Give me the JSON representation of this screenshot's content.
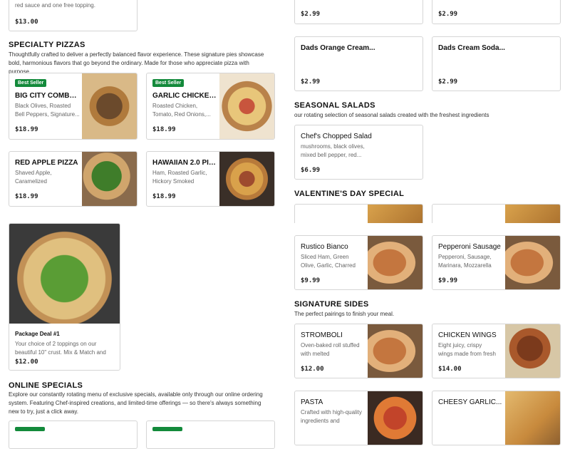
{
  "top_left_card": {
    "desc_tail": "red sauce and one free topping.",
    "price": "$13.00"
  },
  "specialty": {
    "title": "SPECIALTY PIZZAS",
    "description": "Thoughtfully crafted to deliver a perfectly balanced flavor experience. These signature pies showcase bold, harmonious flavors that go beyond the ordinary. Made for those who appreciate pizza with purpose.",
    "items": [
      {
        "badge": "Best Seller",
        "name": "BIG CITY COMBO...",
        "desc": "Black Olives, Roasted Bell Peppers, Signature...",
        "price": "$18.99"
      },
      {
        "badge": "Best Seller",
        "name": "GARLIC CHICKEN...",
        "desc": "Roasted Chicken, Tomato, Red Onions,...",
        "price": "$18.99"
      },
      {
        "name": "RED APPLE PIZZA",
        "desc": "Shaved Apple, Caramelized Onions,...",
        "price": "$18.99"
      },
      {
        "name": "HAWAIIAN 2.0 PIZZA",
        "desc": "Ham, Roasted Garlic, Hickory Smoked Bacon,...",
        "price": "$18.99"
      }
    ]
  },
  "package_deal": {
    "name": "Package Deal #1",
    "desc": "Your choice of 2 toppings on our beautiful 10\" crust. Mix & Match and enjoy!",
    "price": "$12.00"
  },
  "online_specials": {
    "title": "ONLINE SPECIALS",
    "description": "Explore our constantly rotating menu of exclusive specials, available only through our online ordering system. Featuring Chef-inspired creations, and limited-time offerings — so there's always something new to try, just a click away."
  },
  "drinks": [
    {
      "price": "$2.99"
    },
    {
      "price": "$2.99"
    },
    {
      "name": "Dads Orange Cream...",
      "price": "$2.99"
    },
    {
      "name": "Dads Cream Soda...",
      "price": "$2.99"
    }
  ],
  "salads": {
    "title": "SEASONAL SALADS",
    "description": "our rotating selection of seasonal salads created with the freshest ingredients",
    "items": [
      {
        "name": "Chef's Chopped Salad",
        "desc": "mushrooms, black olives, mixed bell pepper, red...",
        "price": "$6.99"
      }
    ]
  },
  "valentines": {
    "title": "VALENTINE'S DAY SPECIAL",
    "items": [
      {
        "name": "Rustico Bianco",
        "desc": "Sliced Ham, Green Olive, Garlic, Charred Tomato,...",
        "price": "$9.99"
      },
      {
        "name": "Pepperoni Sausage",
        "desc": "Pepperoni, Sausage, Marinara, Mozzarella",
        "price": "$9.99"
      }
    ]
  },
  "sides": {
    "title": "SIGNATURE SIDES",
    "description": "The perfect pairings to finish your meal.",
    "items": [
      {
        "name": "STROMBOLI",
        "desc": "Oven-baked roll stuffed with melted mozzarella,...",
        "price": "$12.00"
      },
      {
        "name": "CHICKEN WINGS",
        "desc": "Eight juicy, crispy wings made from fresh chicke...",
        "price": "$14.00"
      },
      {
        "name": "PASTA",
        "desc": "Crafted with high-quality ingredients and house-..."
      },
      {
        "name": "CHEESY GARLIC..."
      }
    ]
  }
}
